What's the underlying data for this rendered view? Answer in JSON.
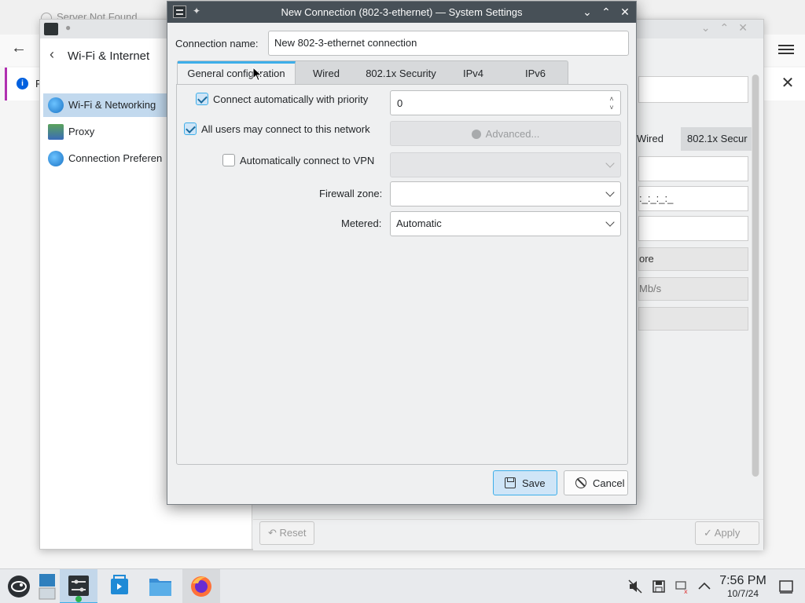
{
  "browser": {
    "tab_title": "Server Not Found",
    "infobar_text": "F"
  },
  "settings": {
    "sidebar_title": "Wi-Fi & Internet",
    "sidebar_items": [
      {
        "label": "Wi-Fi & Networking",
        "icon": "globe-icon"
      },
      {
        "label": "Proxy",
        "icon": "proxy-icon"
      },
      {
        "label": "Connection Preferen",
        "icon": "globe-icon"
      }
    ],
    "bg_tabs": [
      "Wired",
      "802.1x Secur"
    ],
    "bg_mac": ":_:_:_:_",
    "bg_ignore": "ore",
    "bg_speed": "Mb/s",
    "reset_label": "Reset",
    "apply_label": "Apply"
  },
  "dialog": {
    "title": "New Connection (802-3-ethernet) — System Settings",
    "connection_name_label": "Connection name:",
    "connection_name_value": "New 802-3-ethernet connection",
    "tabs": [
      "General configuration",
      "Wired",
      "802.1x Security",
      "IPv4",
      "IPv6"
    ],
    "active_tab": "General configuration",
    "connect_auto_label": "Connect automatically with priority",
    "connect_auto_checked": true,
    "priority_value": "0",
    "all_users_label": "All users may connect to this network",
    "all_users_checked": true,
    "advanced_label": "Advanced...",
    "auto_vpn_label": "Automatically connect to VPN",
    "auto_vpn_checked": false,
    "firewall_label": "Firewall zone:",
    "firewall_value": "",
    "metered_label": "Metered:",
    "metered_value": "Automatic",
    "save_label": "Save",
    "cancel_label": "Cancel"
  },
  "taskbar": {
    "time": "7:56 PM",
    "date": "10/7/24"
  },
  "colors": {
    "accent": "#3daee9",
    "titlebar": "#475057",
    "selection": "#c2d9ee"
  }
}
